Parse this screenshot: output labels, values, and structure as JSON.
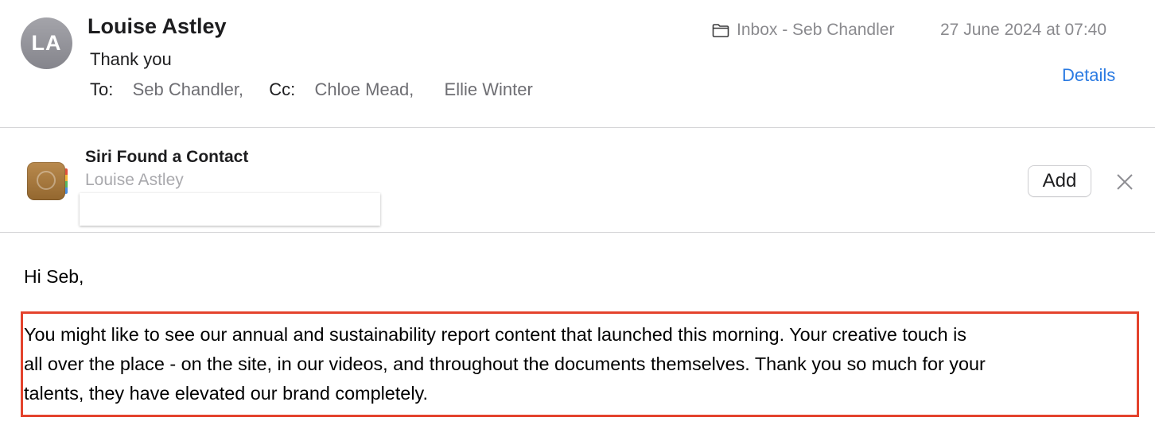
{
  "header": {
    "avatar_initials": "LA",
    "sender": "Louise Astley",
    "subject": "Thank you",
    "to_label": "To:",
    "to_value": "Seb Chandler,",
    "cc_label": "Cc:",
    "cc_values": [
      "Chloe Mead,",
      "Ellie Winter"
    ],
    "mailbox": "Inbox - Seb Chandler",
    "date": "27 June 2024 at 07:40",
    "details_link": "Details"
  },
  "siri_banner": {
    "title": "Siri Found a Contact",
    "contact_name": "Louise Astley",
    "add_button": "Add"
  },
  "body": {
    "greeting": "Hi Seb,",
    "paragraph_lines": [
      "You might like to see our annual and sustainability report content that launched this morning.  Your creative touch is",
      "all over the place - on the site, in our videos, and throughout the documents themselves. Thank you so much for your",
      "talents, they have elevated our brand completely."
    ]
  },
  "colors": {
    "link": "#2a7ae2",
    "highlight_border": "#e4432d",
    "avatar": "#96969c",
    "contacts_icon": "#a87a40"
  },
  "icons": [
    "folder-icon",
    "contacts-app-icon",
    "close-icon"
  ]
}
